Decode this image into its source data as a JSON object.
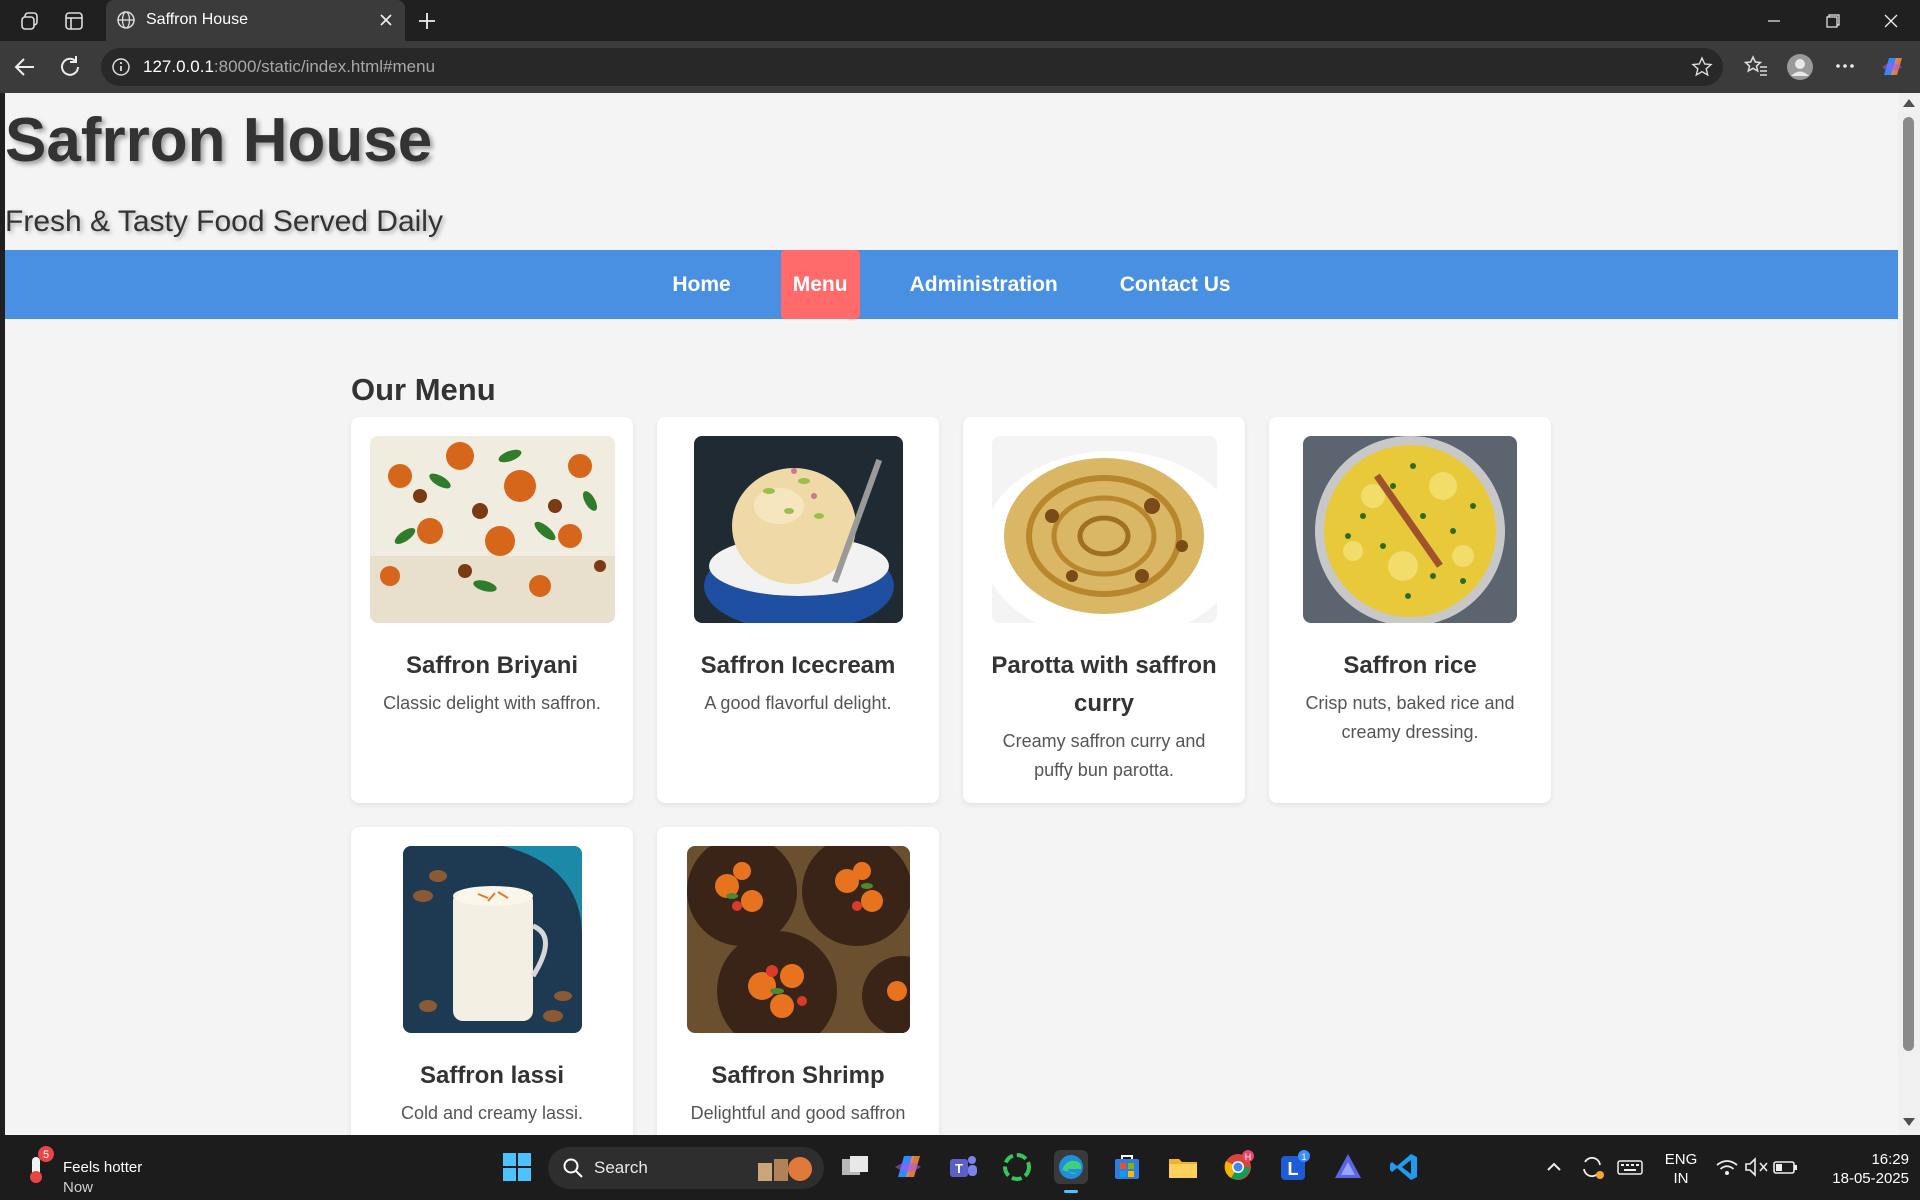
{
  "browser": {
    "tab_title": "Saffron House",
    "url_host": "127.0.0.1",
    "url_rest": ":8000/static/index.html#menu"
  },
  "site": {
    "title": "Safrron House",
    "tagline": "Fresh & Tasty Food Served Daily",
    "nav": [
      {
        "label": "Home"
      },
      {
        "label": "Menu"
      },
      {
        "label": "Administration"
      },
      {
        "label": "Contact Us"
      }
    ],
    "active_nav": "Menu",
    "colors": {
      "nav_bg": "#4a90e2",
      "nav_active": "#ff6b6b",
      "page_bg": "#f4f4f4"
    }
  },
  "menu": {
    "heading": "Our Menu",
    "items": [
      {
        "name": "Saffron Briyani",
        "desc": "Classic delight with saffron.",
        "image": "biryani-image"
      },
      {
        "name": "Saffron Icecream",
        "desc": "A good flavorful delight.",
        "image": "icecream-image"
      },
      {
        "name": "Parotta with saffron curry",
        "desc": "Creamy saffron curry and puffy bun parotta.",
        "image": "parotta-image"
      },
      {
        "name": "Saffron rice",
        "desc": "Crisp nuts, baked rice and creamy dressing.",
        "image": "rice-image"
      },
      {
        "name": "Saffron lassi",
        "desc": "Cold and creamy lassi.",
        "image": "lassi-image"
      },
      {
        "name": "Saffron Shrimp",
        "desc": "Delightful and good saffron",
        "image": "shrimp-image"
      }
    ]
  },
  "taskbar": {
    "weather_title": "Feels hotter",
    "weather_sub": "Now",
    "weather_badge": "5",
    "search_label": "Search",
    "lang_line1": "ENG",
    "lang_line2": "IN",
    "time": "16:29",
    "date": "18-05-2025",
    "chrome_badge": "H",
    "l_badge": "1"
  }
}
